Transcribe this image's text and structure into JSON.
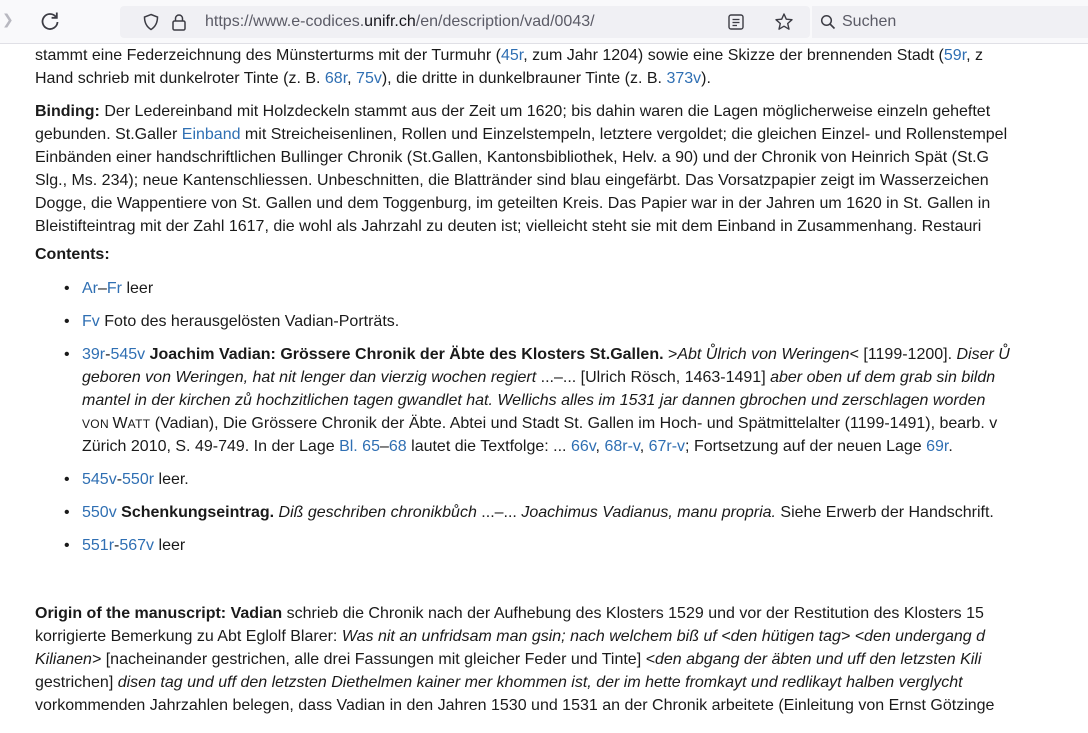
{
  "browser": {
    "url_prefix": "https://www.e-codices.",
    "url_domain": "unifr.ch",
    "url_suffix": "/en/description/vad/0043/",
    "search_placeholder": "Suchen"
  },
  "page": {
    "intro_lines": [
      [
        "stammt eine Federzeichnung des Münsterturms mit der Turmuhr (",
        "45r",
        ", zum Jahr 1204) sowie eine Skizze der brennenden Stadt (",
        "59r",
        ", z"
      ],
      [
        "Hand schrieb mit dunkelroter Tinte (z. B. ",
        "68r",
        ", ",
        "75v",
        "), die dritte in dunkelbrauner Tinte (z. B. ",
        "373v",
        ")."
      ]
    ],
    "binding": {
      "label": "Binding:",
      "line1": " Der Ledereinband mit Holzdeckeln stammt aus der Zeit um 1620; bis dahin waren die Lagen möglicherweise einzeln geheftet",
      "line2_pre": "gebunden. St.Galler ",
      "line2_link": "Einband",
      "line2_post": " mit Streicheisenlinen, Rollen und Einzelstempeln, letztere vergoldet; die gleichen Einzel- und Rollenstempel",
      "line3": "Einbänden einer handschriftlichen Bullinger Chronik (St.Gallen, Kantonsbibliothek, Helv. a 90) und der Chronik von Heinrich Spät (St.G",
      "line4": "Slg., Ms. 234); neue Kantenschliessen. Unbeschnitten, die Blattränder sind blau eingefärbt. Das Vorsatzpapier zeigt im Wasserzeichen",
      "line5": "Dogge, die Wappentiere von St. Gallen und dem Toggenburg, im geteilten Kreis. Das Papier war in der Jahren um 1620 in St. Gallen in",
      "line6": "Bleistifteintrag mit der Zahl 1617, die wohl als Jahrzahl zu deuten ist; vielleicht steht sie mit dem Einband in Zusammenhang. Restauri"
    },
    "contents_heading": "Contents:",
    "contents": {
      "item1": {
        "link_a": "Ar",
        "dash": "–",
        "link_b": "Fr",
        "text": " leer"
      },
      "item2": {
        "link": "Fv",
        "text": " Foto des herausgelösten Vadian-Porträts."
      },
      "item3": {
        "link_a": "39r",
        "dash": "-",
        "link_b": "545v",
        "title": " Joachim Vadian: Grössere Chronik der Äbte des Klosters St.Gallen.",
        "l1_a": " >",
        "l1_i1": "Abt Ůlrich von Weringen",
        "l1_b": "< [1199-1200]. ",
        "l1_i2": "Diser Ů",
        "l2_i": "geboren von Weringen, hat nit lenger dan vierzig wochen regiert",
        "l2_a": " ...–... [Ulrich Rösch, 1463-1491] ",
        "l2_i2": "aber oben uf dem grab sin bildn",
        "l3_i": "mantel in der kirchen zů hochzitlichen tagen gwandlet hat. Wellichs alles im 1531 jar dannen gbrochen und zerschlagen worden",
        "l4_smc1": "VON ",
        "l4_cap": "W",
        "l4_smc2": "ATT",
        "l4_a": " (Vadian), Die Grössere Chronik der Äbte. Abtei und Stadt St. Gallen im Hoch- und Spätmittelalter (1199-1491), bearb. v",
        "l5_a": "Zürich 2010, S. 49-749. In der Lage ",
        "l5_link1": "Bl. 65",
        "l5_dash": "–",
        "l5_link2": "68",
        "l5_b": " lautet die Textfolge: ... ",
        "l5_link3": "66v",
        "l5_c": ", ",
        "l5_link4": "68r-v",
        "l5_d": ", ",
        "l5_link5": "67r-v",
        "l5_e": "; Fortsetzung auf der neuen Lage ",
        "l5_link6": "69r",
        "l5_f": "."
      },
      "item4": {
        "link_a": "545v",
        "dash": "-",
        "link_b": "550r",
        "text": " leer."
      },
      "item5": {
        "link": "550v",
        "title": " Schenkungseintrag.",
        "sp": " ",
        "i1": "Diß geschriben chronikbůch",
        "mid": " ...–... ",
        "i2": "Joachimus Vadianus, manu propria.",
        "text": " Siehe Erwerb der Handschrift."
      },
      "item6": {
        "link_a": "551r",
        "dash": "-",
        "link_b": "567v",
        "text": " leer"
      }
    },
    "origin": {
      "label": "Origin of the manuscript: Vadian",
      "l1": " schrieb die Chronik nach der Aufhebung des Klosters 1529 und vor der Restitution des Klosters 15",
      "l2_a": "korrigierte Bemerkung zu Abt Eglolf Blarer: ",
      "l2_i": "Was nit an unfridsam man gsin; nach welchem biß uf <den hütigen tag> <den undergang d",
      "l3_i": "Kilianen>",
      "l3_a": " [nacheinander gestrichen, alle drei Fassungen mit gleicher Feder und Tinte] ",
      "l3_i2": "<den abgang der äbten und uff den letzsten Kili",
      "l4_a": "gestrichen] ",
      "l4_i": "disen tag und uff den letzsten Diethelmen kainer mer khommen ist, der im hette fromkayt und redlikayt halben verglycht",
      "l5": "vorkommenden Jahrzahlen belegen, dass Vadian in den Jahren 1530 und 1531 an der Chronik arbeitete (Einleitung von Ernst Götzinge"
    }
  }
}
